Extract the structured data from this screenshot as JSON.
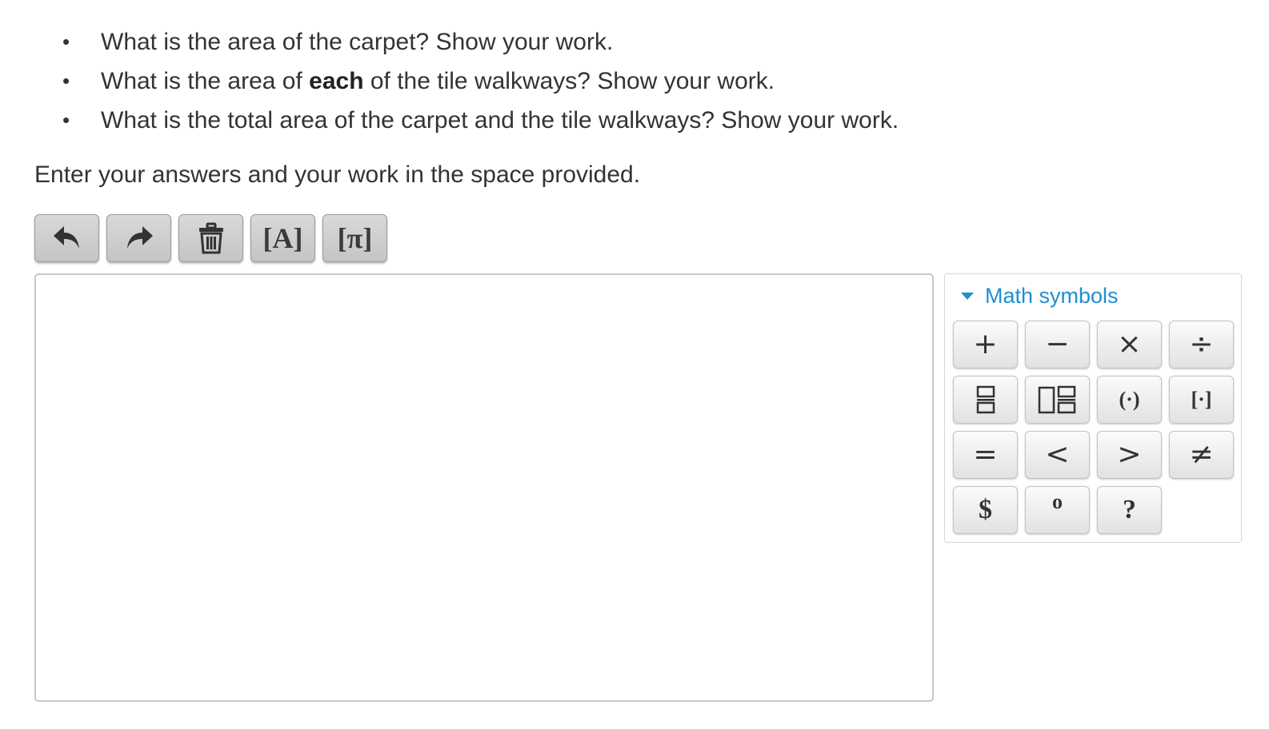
{
  "questions": [
    {
      "bullet": "•",
      "text": "What is the area of the carpet? Show your work."
    },
    {
      "bullet": "•",
      "pre": "What is the area of ",
      "bold": "each",
      "post": " of the tile walkways? Show your work."
    },
    {
      "bullet": "•",
      "text": "What is the total area of the carpet and the tile walkways? Show your work."
    }
  ],
  "instruction": "Enter your answers and your work in the space provided.",
  "toolbar": {
    "undo_icon": "undo-icon",
    "redo_icon": "redo-icon",
    "delete_icon": "trash-icon",
    "text_label": "[A]",
    "math_label": "[π]"
  },
  "math_panel": {
    "title": "Math symbols",
    "accent": "#1f8fd1",
    "symbols": {
      "plus": "+",
      "minus": "−",
      "times": "×",
      "divide": "÷",
      "fraction_icon": "fraction-icon",
      "mixed_number_icon": "mixed-number-icon",
      "parentheses": "(·)",
      "brackets": "[·]",
      "equals": "=",
      "less_than": "<",
      "greater_than": ">",
      "not_equal": "≠",
      "dollar": "$",
      "degree": "o",
      "question": "?"
    }
  }
}
